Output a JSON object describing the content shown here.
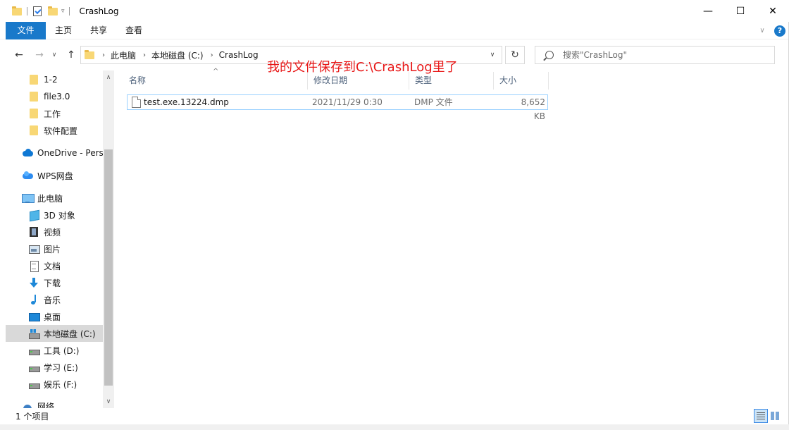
{
  "window": {
    "title": "CrashLog",
    "minimize": "—",
    "maximize": "☐",
    "close": "✕"
  },
  "ribbon": {
    "tabs": [
      "文件",
      "主页",
      "共享",
      "查看"
    ],
    "help": "?"
  },
  "address": {
    "crumbs": [
      "此电脑",
      "本地磁盘 (C:)",
      "CrashLog"
    ],
    "search_placeholder": "搜索\"CrashLog\""
  },
  "sidebar": {
    "items": [
      {
        "label": "1-2",
        "icon": "folder-icon"
      },
      {
        "label": "file3.0",
        "icon": "folder-icon"
      },
      {
        "label": "工作",
        "icon": "folder-icon"
      },
      {
        "label": "软件配置",
        "icon": "folder-icon"
      },
      {
        "label": "OneDrive - Pers",
        "icon": "onedrive-icon"
      },
      {
        "label": "WPS网盘",
        "icon": "wps-cloud-icon"
      },
      {
        "label": "此电脑",
        "icon": "this-pc-icon"
      },
      {
        "label": "3D 对象",
        "icon": "3d-objects-icon"
      },
      {
        "label": "视频",
        "icon": "video-icon"
      },
      {
        "label": "图片",
        "icon": "pictures-icon"
      },
      {
        "label": "文档",
        "icon": "documents-icon"
      },
      {
        "label": "下载",
        "icon": "download-icon"
      },
      {
        "label": "音乐",
        "icon": "music-icon"
      },
      {
        "label": "桌面",
        "icon": "desktop-icon"
      },
      {
        "label": "本地磁盘 (C:)",
        "icon": "system-drive-icon",
        "selected": true
      },
      {
        "label": "工具 (D:)",
        "icon": "drive-icon"
      },
      {
        "label": "学习 (E:)",
        "icon": "drive-icon"
      },
      {
        "label": "娱乐 (F:)",
        "icon": "drive-icon"
      },
      {
        "label": "网络",
        "icon": "network-icon"
      }
    ]
  },
  "list": {
    "columns": [
      "名称",
      "修改日期",
      "类型",
      "大小"
    ],
    "rows": [
      {
        "name": "test.exe.13224.dmp",
        "modified": "2021/11/29 0:30",
        "type": "DMP 文件",
        "size": "8,652 KB"
      }
    ],
    "annotation": "我的文件保存到C:\\CrashLog里了",
    "annotation_color": "#e81818"
  },
  "status": {
    "item_count": "1 个项目"
  },
  "colors": {
    "accent": "#1979ca",
    "selection": "#d9d9d9",
    "row_border": "#99d1ff"
  }
}
